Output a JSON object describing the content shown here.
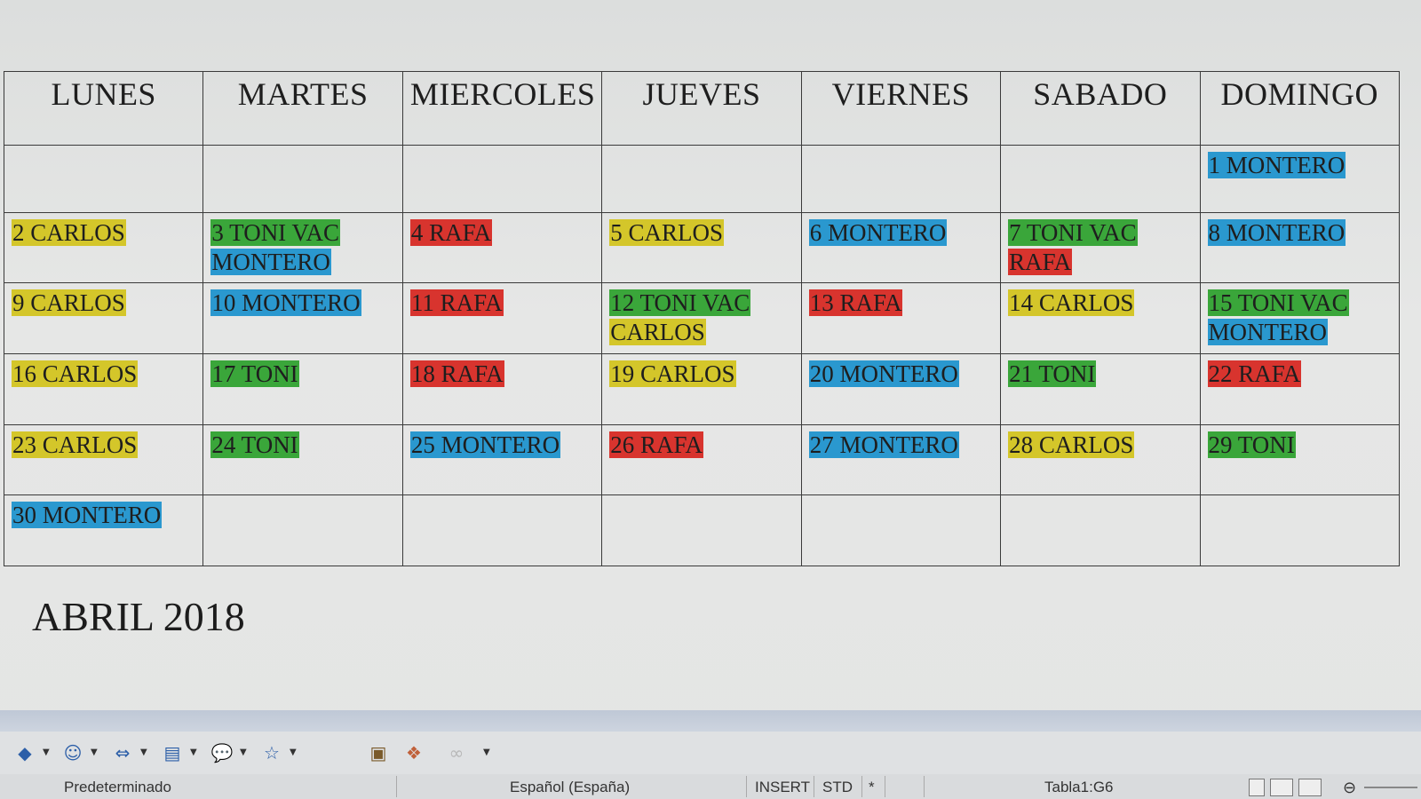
{
  "calendar": {
    "headers": [
      "LUNES",
      "MARTES",
      "MIERCOLES",
      "JUEVES",
      "VIERNES",
      "SABADO",
      "DOMINGO"
    ],
    "weeks": [
      [
        [],
        [],
        [],
        [],
        [],
        [],
        [
          {
            "text": "1 MONTERO",
            "color": "b"
          }
        ]
      ],
      [
        [
          {
            "text": "2 CARLOS",
            "color": "y"
          }
        ],
        [
          {
            "text": "3 TONI VAC",
            "color": "g"
          },
          {
            "text": "MONTERO",
            "color": "b"
          }
        ],
        [
          {
            "text": "4 RAFA",
            "color": "r"
          }
        ],
        [
          {
            "text": "5 CARLOS",
            "color": "y"
          }
        ],
        [
          {
            "text": "6 MONTERO",
            "color": "b"
          }
        ],
        [
          {
            "text": "7 TONI VAC",
            "color": "g"
          },
          {
            "text": "RAFA",
            "color": "r"
          }
        ],
        [
          {
            "text": "8 MONTERO",
            "color": "b"
          }
        ]
      ],
      [
        [
          {
            "text": "9 CARLOS",
            "color": "y"
          }
        ],
        [
          {
            "text": "10 MONTERO",
            "color": "b"
          }
        ],
        [
          {
            "text": "11 RAFA",
            "color": "r"
          }
        ],
        [
          {
            "text": "12 TONI VAC",
            "color": "g"
          },
          {
            "text": "CARLOS",
            "color": "y"
          }
        ],
        [
          {
            "text": "13 RAFA",
            "color": "r"
          }
        ],
        [
          {
            "text": "14  CARLOS",
            "color": "y"
          }
        ],
        [
          {
            "text": "15 TONI VAC",
            "color": "g"
          },
          {
            "text": "MONTERO",
            "color": "b"
          }
        ]
      ],
      [
        [
          {
            "text": "16 CARLOS",
            "color": "y"
          }
        ],
        [
          {
            "text": "17 TONI",
            "color": "g"
          }
        ],
        [
          {
            "text": "18 RAFA",
            "color": "r"
          }
        ],
        [
          {
            "text": "19 CARLOS",
            "color": "y"
          }
        ],
        [
          {
            "text": "20 MONTERO",
            "color": "b"
          }
        ],
        [
          {
            "text": "21 TONI",
            "color": "g"
          }
        ],
        [
          {
            "text": "22 RAFA",
            "color": "r"
          }
        ]
      ],
      [
        [
          {
            "text": "23 CARLOS",
            "color": "y"
          }
        ],
        [
          {
            "text": "24 TONI",
            "color": "g"
          }
        ],
        [
          {
            "text": "25 MONTERO",
            "color": "b"
          }
        ],
        [
          {
            "text": "26 RAFA",
            "color": "r"
          }
        ],
        [
          {
            "text": "27 MONTERO",
            "color": "b"
          }
        ],
        [
          {
            "text": "28 CARLOS",
            "color": "y"
          }
        ],
        [
          {
            "text": "29 TONI",
            "color": "g"
          }
        ]
      ],
      [
        [
          {
            "text": "30 MONTERO",
            "color": "b"
          }
        ],
        [],
        [],
        [],
        [],
        [],
        []
      ]
    ]
  },
  "colors": {
    "y": "#d4c62a",
    "g": "#3aa63a",
    "r": "#d8342e",
    "b": "#2a98cf"
  },
  "doc_title": "ABRIL 2018",
  "toolbar": {
    "icons": [
      "diamond-shape-icon",
      "smiley-shape-icon",
      "arrow-shape-icon",
      "flowchart-shape-icon",
      "callout-shape-icon",
      "star-shape-icon",
      "text-box-icon",
      "fontwork-icon"
    ]
  },
  "status": {
    "page_style": "Predeterminado",
    "language": "Español (España)",
    "insert_mode": "INSERT",
    "selection_mode": "STD",
    "modified": "*",
    "cell_ref": "Tabla1:G6"
  }
}
